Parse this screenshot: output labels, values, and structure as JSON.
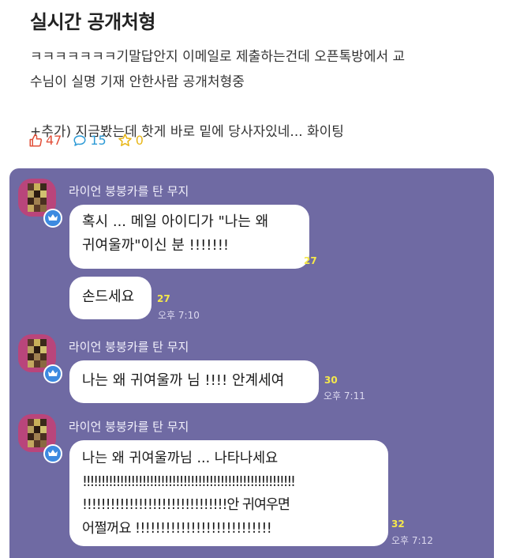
{
  "post": {
    "title": "실시간 공개처형",
    "body_line1": "ㅋㅋㅋㅋㅋㅋㅋ기말답안지 이메일로 제출하는건데 오픈톡방에서 교",
    "body_line2": "수님이 실명 기재 안한사람 공개처형중",
    "body_line3": "+추가) 지금봤는데 핫게 바로 밑에 당사자있네... 화이팅",
    "likes": "47",
    "comments": "15",
    "stars": "0"
  },
  "chat": {
    "background": "#6f6aa3",
    "messages": [
      {
        "sender": "라이언 붕붕카를 탄 무지",
        "bubbles": [
          {
            "lines": [
              "혹시 ... 메일 아이디가 \"나는 왜",
              "귀여울까\"이신 분 !!!!!!!"
            ],
            "unread": "27",
            "time": ""
          },
          {
            "lines": [
              "손드세요"
            ],
            "unread": "27",
            "time": "오후 7:10"
          }
        ]
      },
      {
        "sender": "라이언 붕붕카를 탄 무지",
        "bubbles": [
          {
            "lines": [
              "나는 왜 귀여울까 님 !!!! 안계세여"
            ],
            "unread": "30",
            "time": "오후 7:11"
          }
        ]
      },
      {
        "sender": "라이언 붕붕카를 탄 무지",
        "bubbles": [
          {
            "lines": [
              "나는 왜 귀여울까님 ... 나타나세요",
              "!!!!!!!!!!!!!!!!!!!!!!!!!!!!!!!!!!!!!!!!!!!!!!!!!!!!!!!!!",
              "!!!!!!!!!!!!!!!!!!!!!!!!!!!!!!!안 귀여우면",
              "어쩔꺼요 !!!!!!!!!!!!!!!!!!!!!!!!!!!"
            ],
            "unread": "32",
            "time": "오후 7:12"
          }
        ]
      }
    ]
  },
  "icons": {
    "like": "thumbs-up-icon",
    "comment": "speech-bubble-icon",
    "star": "star-icon",
    "crown": "crown-icon"
  },
  "colors": {
    "like": "#e2503a",
    "comment": "#2e9bd6",
    "star": "#e8b71a",
    "unread": "#f5e84b",
    "bubble": "#ffffff"
  }
}
